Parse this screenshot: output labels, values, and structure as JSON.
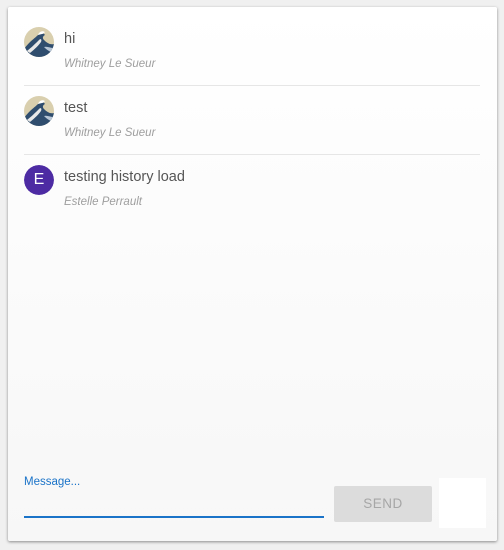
{
  "messages": [
    {
      "text": "hi",
      "author": "Whitney Le Sueur",
      "avatar": {
        "type": "image",
        "icon": "wave-painting-avatar-icon"
      }
    },
    {
      "text": "test",
      "author": "Whitney Le Sueur",
      "avatar": {
        "type": "image",
        "icon": "wave-painting-avatar-icon"
      }
    },
    {
      "text": "testing history load",
      "author": "Estelle Perrault",
      "avatar": {
        "type": "letter",
        "letter": "E",
        "color": "#4d2ba3"
      }
    }
  ],
  "composer": {
    "label": "Message...",
    "value": "",
    "send_label": "SEND"
  },
  "colors": {
    "accent": "#1a73c8",
    "avatar_letter_bg": "#4d2ba3",
    "send_disabled_bg": "#dcdcdc",
    "send_disabled_text": "#a6a6a6"
  }
}
